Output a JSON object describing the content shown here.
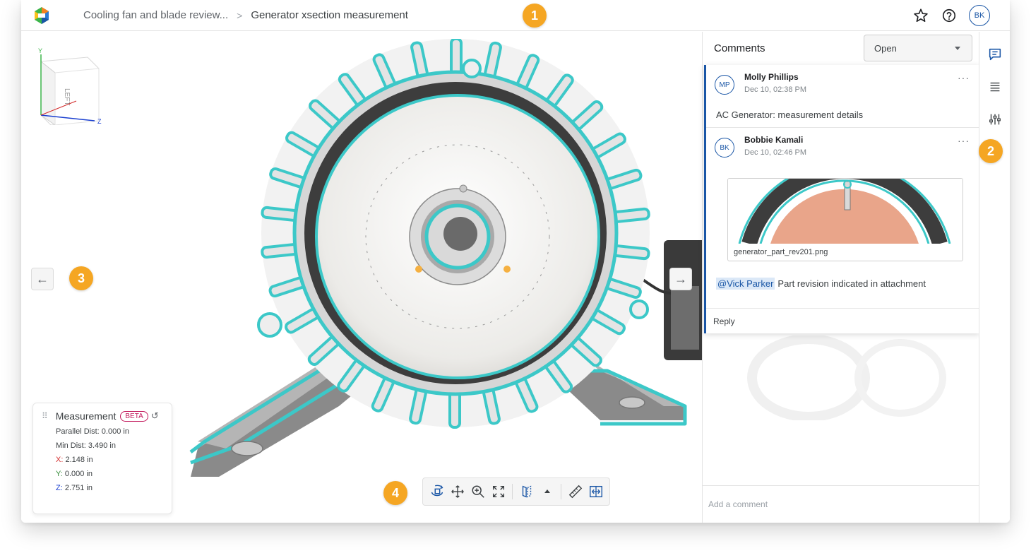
{
  "header": {
    "breadcrumb_parent": "Cooling fan and blade review...",
    "breadcrumb_separator": ">",
    "breadcrumb_current": "Generator xsection measurement",
    "user_initials": "BK",
    "icons": [
      "star-icon",
      "help-icon"
    ]
  },
  "viewer": {
    "gizmo": {
      "face_label": "LEFT",
      "axis_y": "Y",
      "axis_z": "Z"
    },
    "prev_arrow": "←",
    "next_arrow": "→"
  },
  "measurement": {
    "title": "Measurement",
    "badge": "BETA",
    "parallel_dist": "Parallel Dist: 0.000 in",
    "min_dist": "Min Dist: 3.490 in",
    "x_key": "X:",
    "x_value": "2.148 in",
    "y_key": "Y:",
    "y_value": "0.000 in",
    "z_key": "Z:",
    "z_value": "2.751 in"
  },
  "toolbar": {
    "tools": [
      "orbit-icon",
      "pan-icon",
      "zoom-icon",
      "fit-icon",
      "section-icon",
      "measure-icon",
      "explode-icon"
    ]
  },
  "comments": {
    "title": "Comments",
    "filter_value": "Open",
    "thread": [
      {
        "initials": "MP",
        "author": "Molly Phillips",
        "date": "Dec 10, 02:38 PM",
        "text": "AC Generator: measurement details"
      },
      {
        "initials": "BK",
        "author": "Bobbie Kamali",
        "date": "Dec 10, 02:46 PM",
        "attachment_name": "generator_part_rev201.png",
        "mention": "@Vick Parker",
        "text": "Part revision indicated in attachment"
      }
    ],
    "more": "···",
    "reply_label": "Reply",
    "add_placeholder": "Add a comment"
  },
  "rail": {
    "icons": [
      "comment-icon",
      "list-icon",
      "sliders-icon"
    ]
  },
  "callouts": [
    "1",
    "2",
    "3",
    "4"
  ],
  "colors": {
    "accent": "#1a56a6",
    "callout": "#f5a623",
    "outline": "#3cc8c8"
  }
}
